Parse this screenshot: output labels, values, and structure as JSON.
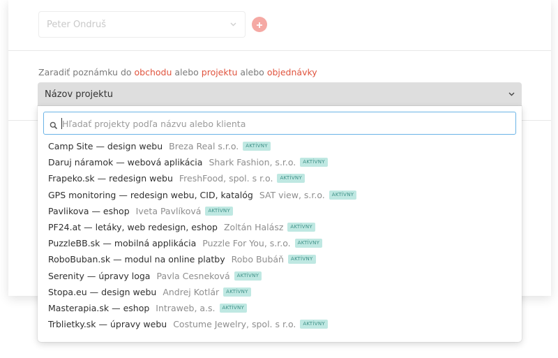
{
  "person_select": {
    "value": "Peter Ondruš",
    "chevron_icon": "chevron-down-icon",
    "add_icon": "plus-icon"
  },
  "assign": {
    "prefix": "Zaradiť poznámku do ",
    "link_order": "obchodu",
    "sep1": " alebo ",
    "link_project": "projektu",
    "sep2": " alebo ",
    "link_invoice": "objednávky"
  },
  "project_select": {
    "label": "Názov projektu",
    "chevron_icon": "chevron-down-icon"
  },
  "search": {
    "placeholder": "Hľadať projekty podľa názvu alebo klienta",
    "icon": "search-icon"
  },
  "colors": {
    "accent_link": "#e0533d",
    "badge_bg": "#bfe8e2",
    "badge_text": "#3d8f86",
    "focus_border": "#6ab3e6"
  },
  "options": [
    {
      "project": "Camp Site — design webu",
      "client": "Breza Real s.r.o.",
      "status": "AKTÍVNY"
    },
    {
      "project": "Daruj náramok — webová aplikácia",
      "client": "Shark Fashion, s.r.o.",
      "status": "AKTÍVNY"
    },
    {
      "project": "Frapeko.sk — redesign webu",
      "client": "FreshFood, spol. s r.o.",
      "status": "AKTÍVNY"
    },
    {
      "project": "GPS monitoring — redesign webu, CID, katalóg",
      "client": "SAT view, s.r.o.",
      "status": "AKTÍVNY"
    },
    {
      "project": "Pavlikova — eshop",
      "client": "Iveta Pavlíková",
      "status": "AKTÍVNY"
    },
    {
      "project": "PF24.at — letáky, web redesign, eshop",
      "client": "Zoltán Halász",
      "status": "AKTÍVNY"
    },
    {
      "project": "PuzzleBB.sk — mobilná applikácia",
      "client": "Puzzle For You, s.r.o.",
      "status": "AKTÍVNY"
    },
    {
      "project": "RoboBuban.sk — modul na online platby",
      "client": "Robo Bubáň",
      "status": "AKTÍVNY"
    },
    {
      "project": "Serenity — úpravy loga",
      "client": "Pavla Cesneková",
      "status": "AKTÍVNY"
    },
    {
      "project": "Stopa.eu — design webu",
      "client": "Andrej Kotlár",
      "status": "AKTÍVNY"
    },
    {
      "project": "Masterapia.sk — eshop",
      "client": "Intraweb, a.s.",
      "status": "AKTÍVNY"
    },
    {
      "project": "Trblietky.sk — úpravy webu",
      "client": "Costume Jewelry, spol. s r.o.",
      "status": "AKTÍVNY"
    }
  ]
}
